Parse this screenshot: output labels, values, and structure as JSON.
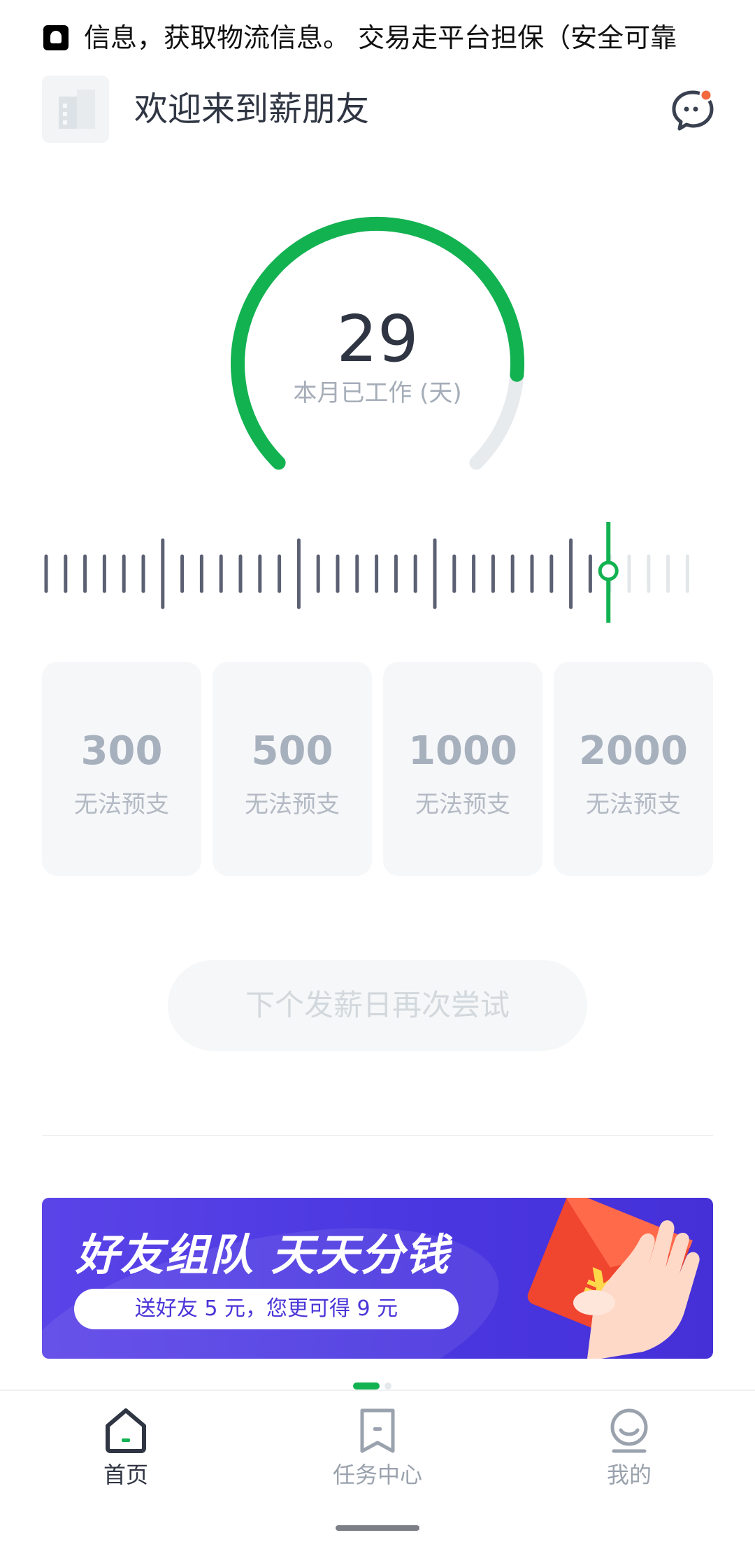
{
  "notification": {
    "icon": "qq-penguin-icon",
    "text": "信息，获取物流信息。 交易走平台担保（安全可靠"
  },
  "header": {
    "logo_icon": "building-icon",
    "title": "欢迎来到薪朋友",
    "message_icon": "chat-bubble-icon",
    "message_badge_color": "#f26a3d"
  },
  "gauge": {
    "value": "29",
    "caption": "本月已工作 (天)",
    "progress_fraction": 0.85,
    "colors": {
      "active": "#12b251",
      "track": "#e8ebee"
    }
  },
  "ruler": {
    "total_ticks": 34,
    "current_tick": 29,
    "colors": {
      "tick": "#5b6072",
      "future": "#e3e7ea",
      "marker": "#12b251"
    }
  },
  "advance_options": [
    {
      "amount": "300",
      "status": "无法预支"
    },
    {
      "amount": "500",
      "status": "无法预支"
    },
    {
      "amount": "1000",
      "status": "无法预支"
    },
    {
      "amount": "2000",
      "status": "无法预支"
    }
  ],
  "action": {
    "label": "下个发薪日再次尝试",
    "enabled": false
  },
  "banner": {
    "headline": "好友组队 天天分钱",
    "subline": "送好友 5 元，您更可得 9 元",
    "art_icon": "red-envelope-icon"
  },
  "bottom_nav": [
    {
      "label": "首页",
      "icon": "home-icon",
      "active": true
    },
    {
      "label": "任务中心",
      "icon": "bookmark-icon",
      "active": false
    },
    {
      "label": "我的",
      "icon": "person-icon",
      "active": false
    }
  ],
  "colors": {
    "accent": "#12b251",
    "text": "#2f3542",
    "muted": "#a5adb8",
    "banner": "#4b37e0"
  }
}
